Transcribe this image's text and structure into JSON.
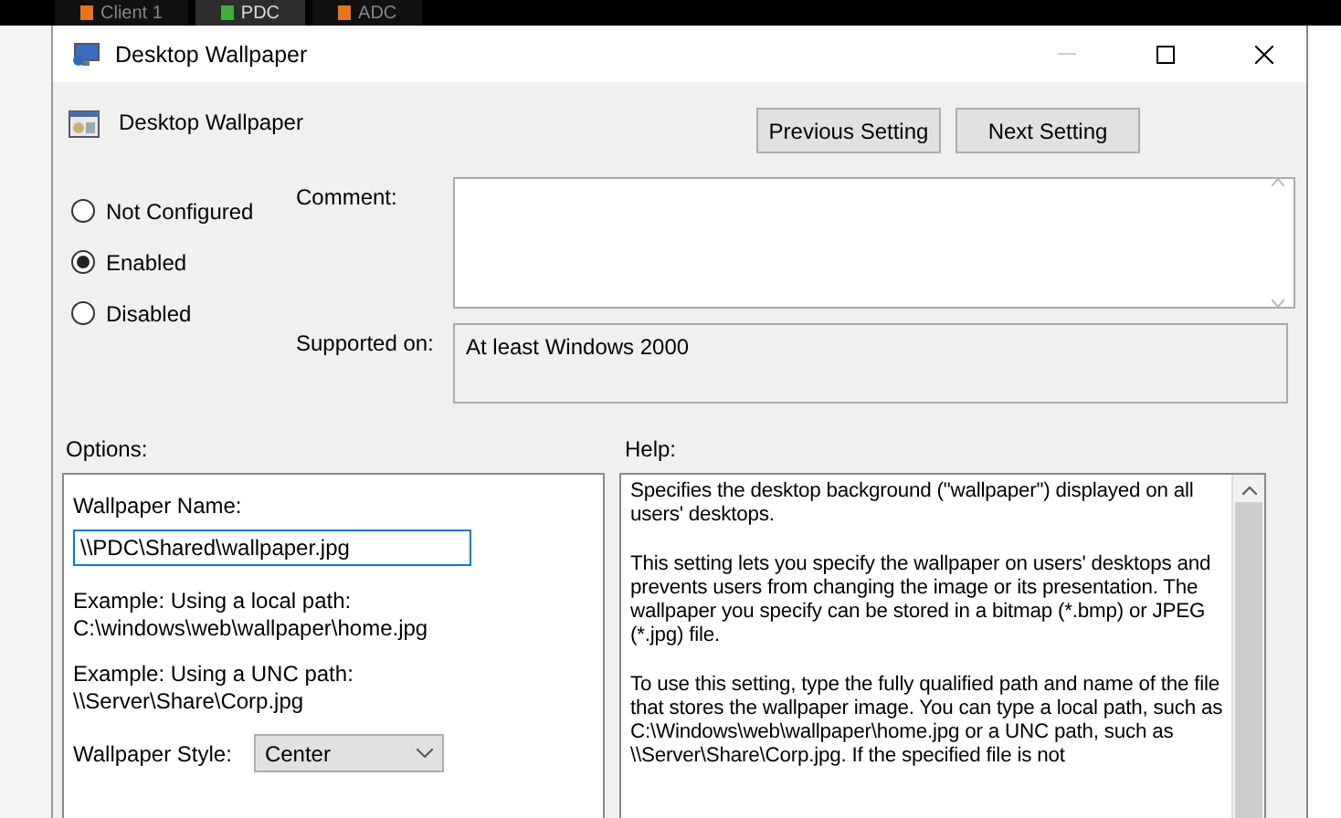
{
  "tabs": [
    {
      "label": "Client 1",
      "selected": false
    },
    {
      "label": "PDC",
      "selected": true
    },
    {
      "label": "ADC",
      "selected": false
    }
  ],
  "window": {
    "title": "Desktop Wallpaper"
  },
  "header": {
    "title": "Desktop Wallpaper"
  },
  "buttons": [
    {
      "label": "Previous Setting"
    },
    {
      "label": "Next Setting"
    }
  ],
  "state_options": [
    {
      "label": "Not Configured",
      "selected": false
    },
    {
      "label": "Enabled",
      "selected": true
    },
    {
      "label": "Disabled",
      "selected": false
    }
  ],
  "comment": {
    "label": "Comment:"
  },
  "supported_on": {
    "label": "Supported on:",
    "value": "At least Windows 2000"
  },
  "options": {
    "label": "Options:",
    "name_label": "Wallpaper Name:",
    "name_value": "\\\\PDC\\Shared\\wallpaper.jpg",
    "examples": [
      {
        "caption": "Example: Using a local path:",
        "path": "C:\\windows\\web\\wallpaper\\home.jpg"
      },
      {
        "caption": "Example: Using a UNC path:",
        "path": "\\\\Server\\Share\\Corp.jpg"
      }
    ],
    "style_label": "Wallpaper Style:",
    "style_value": "Center"
  },
  "help": {
    "label": "Help:",
    "paragraphs": [
      "Specifies the desktop background (\"wallpaper\") displayed on all users' desktops.",
      "This setting lets you specify the wallpaper on users' desktops and prevents users from changing the image or its presentation. The wallpaper you specify can be stored in a bitmap (*.bmp) or JPEG (*.jpg) file.",
      "To use this setting, type the fully qualified path and name of the file that stores the wallpaper image. You can type a local path, such as C:\\Windows\\web\\wallpaper\\home.jpg or a UNC path, such as \\\\Server\\Share\\Corp.jpg. If the specified file is not"
    ]
  }
}
